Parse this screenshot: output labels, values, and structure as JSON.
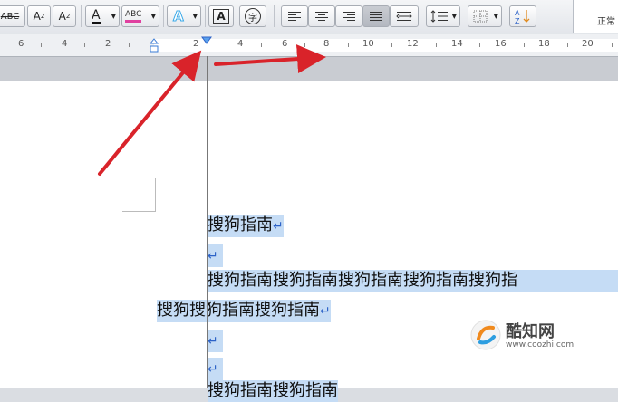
{
  "toolbar": {
    "strike_label": "ABC",
    "superscript_label": "A",
    "subscript_label": "A",
    "font_color_label": "A",
    "highlight_label": "ABC",
    "text_effect_label": "A",
    "char_border_label": "A",
    "enclosed_char_label": "字",
    "style_gallery_label": "正常",
    "accent_colors": {
      "font_color": "#111111",
      "highlight": "#e040a0",
      "text_effect": "#38a8e8"
    }
  },
  "ruler": {
    "numbers": [
      "6",
      "4",
      "2",
      "2",
      "4",
      "6",
      "8",
      "10",
      "12",
      "14",
      "16",
      "18",
      "20"
    ]
  },
  "document": {
    "line1": "搜狗指南",
    "line3": "搜狗指南搜狗指南搜狗指南搜狗指南搜狗指",
    "line4": "搜狗搜狗指南搜狗指南",
    "line7": "搜狗指南搜狗指南",
    "pilcrow": "↵"
  },
  "watermark": {
    "name": "酷知网",
    "url": "www.coozhi.com"
  },
  "annotation_color": "#d9232a"
}
